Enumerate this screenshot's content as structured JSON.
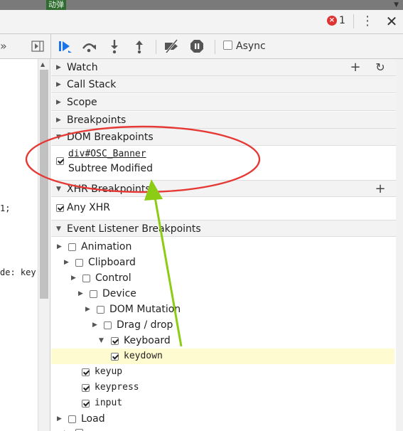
{
  "top_strip": {
    "tag_text": "动弹"
  },
  "title_bar": {
    "error_count": "1",
    "error_badge_text": "×"
  },
  "toolbar": {
    "async_label": "Async",
    "icons": [
      "resume-icon",
      "step-over-icon",
      "step-into-icon",
      "step-out-icon",
      "deactivate-breakpoints-icon",
      "pause-on-exceptions-icon"
    ]
  },
  "left_toolbar": {
    "more": "»"
  },
  "code_fragments": [
    {
      "text": "1;"
    },
    {
      "text": "de: key"
    }
  ],
  "sections": {
    "watch": {
      "title": "Watch",
      "expanded": false
    },
    "call_stack": {
      "title": "Call Stack",
      "expanded": false
    },
    "scope": {
      "title": "Scope",
      "expanded": false
    },
    "breakpoints": {
      "title": "Breakpoints",
      "expanded": false
    },
    "dom_breakpoints": {
      "title": "DOM Breakpoints",
      "expanded": true,
      "items": [
        {
          "node": "div#OSC_Banner",
          "type": "Subtree Modified",
          "checked": true
        }
      ]
    },
    "xhr_breakpoints": {
      "title": "XHR Breakpoints",
      "expanded": true,
      "items": [
        {
          "label": "Any XHR",
          "checked": true
        }
      ]
    },
    "event_listener_breakpoints": {
      "title": "Event Listener Breakpoints",
      "expanded": true,
      "items": [
        {
          "label": "Animation",
          "checked": false,
          "expandable": true,
          "expanded": false
        },
        {
          "label": "Clipboard",
          "checked": false,
          "expandable": true,
          "expanded": false
        },
        {
          "label": "Control",
          "checked": false,
          "expandable": true,
          "expanded": false
        },
        {
          "label": "Device",
          "checked": false,
          "expandable": true,
          "expanded": false
        },
        {
          "label": "DOM Mutation",
          "checked": false,
          "expandable": true,
          "expanded": false
        },
        {
          "label": "Drag / drop",
          "checked": false,
          "expandable": true,
          "expanded": false
        },
        {
          "label": "Keyboard",
          "checked": true,
          "expandable": true,
          "expanded": true
        },
        {
          "label": "keydown",
          "checked": true,
          "expandable": false,
          "highlighted": true
        },
        {
          "label": "keyup",
          "checked": true,
          "expandable": false
        },
        {
          "label": "keypress",
          "checked": true,
          "expandable": false
        },
        {
          "label": "input",
          "checked": true,
          "expandable": false
        },
        {
          "label": "Load",
          "checked": false,
          "expandable": true,
          "expanded": false
        }
      ]
    }
  },
  "colors": {
    "annotation_red": "#e53935",
    "annotation_arrow": "#8ccc14",
    "highlight": "#fffbd0"
  }
}
